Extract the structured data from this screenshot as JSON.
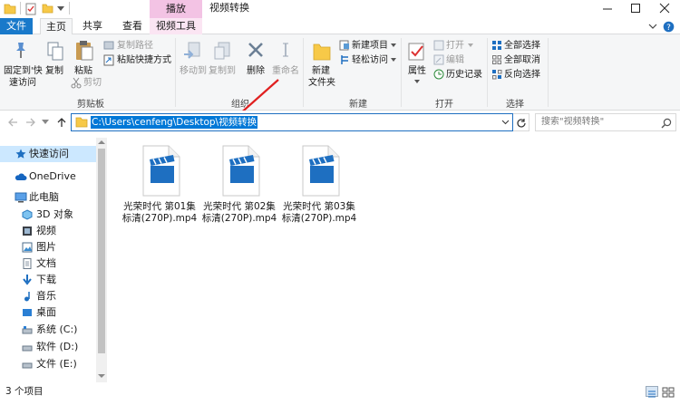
{
  "titlebar": {
    "context_tab": "播放",
    "title": "视频转换",
    "minimize_icon": "minimize-icon",
    "maximize_icon": "maximize-icon",
    "close_icon": "close-icon"
  },
  "tabs": {
    "file": "文件",
    "home": "主页",
    "share": "共享",
    "view": "查看",
    "video_tools": "视频工具"
  },
  "ribbon": {
    "clipboard": {
      "pin": "固定到快速访问",
      "pin_line1": "固定到'快",
      "pin_line2": "速访问",
      "copy": "复制",
      "paste": "粘贴",
      "copy_path": "复制路径",
      "paste_shortcut": "粘贴快捷方式",
      "cut": "剪切",
      "label": "剪贴板"
    },
    "organize": {
      "move_to": "移动到",
      "copy_to": "复制到",
      "delete": "删除",
      "rename": "重命名",
      "label": "组织"
    },
    "new": {
      "new_folder_line1": "新建",
      "new_folder_line2": "文件夹",
      "new_item": "新建项目",
      "easy_access": "轻松访问",
      "label": "新建"
    },
    "open": {
      "properties": "属性",
      "open": "打开",
      "edit": "编辑",
      "history": "历史记录",
      "label": "打开"
    },
    "select": {
      "select_all": "全部选择",
      "select_none": "全部取消",
      "invert": "反向选择",
      "label": "选择"
    }
  },
  "address": {
    "path": "C:\\Users\\cenfeng\\Desktop\\视频转换",
    "search_placeholder": "搜索\"视频转换\""
  },
  "sidebar": {
    "quick_access": "快速访问",
    "onedrive": "OneDrive",
    "this_pc": "此电脑",
    "items": [
      "3D 对象",
      "视频",
      "图片",
      "文档",
      "下载",
      "音乐",
      "桌面",
      "系统 (C:)",
      "软件 (D:)",
      "文件 (E:)"
    ]
  },
  "files": [
    {
      "line1": "光荣时代 第01集",
      "line2": "标清(270P).mp4"
    },
    {
      "line1": "光荣时代 第02集",
      "line2": "标清(270P).mp4"
    },
    {
      "line1": "光荣时代 第03集",
      "line2": "标清(270P).mp4"
    }
  ],
  "status": {
    "count": "3 个项目"
  },
  "colors": {
    "accent": "#1979ca",
    "play_tab": "#f3c3e4",
    "selection": "#0078d7"
  }
}
